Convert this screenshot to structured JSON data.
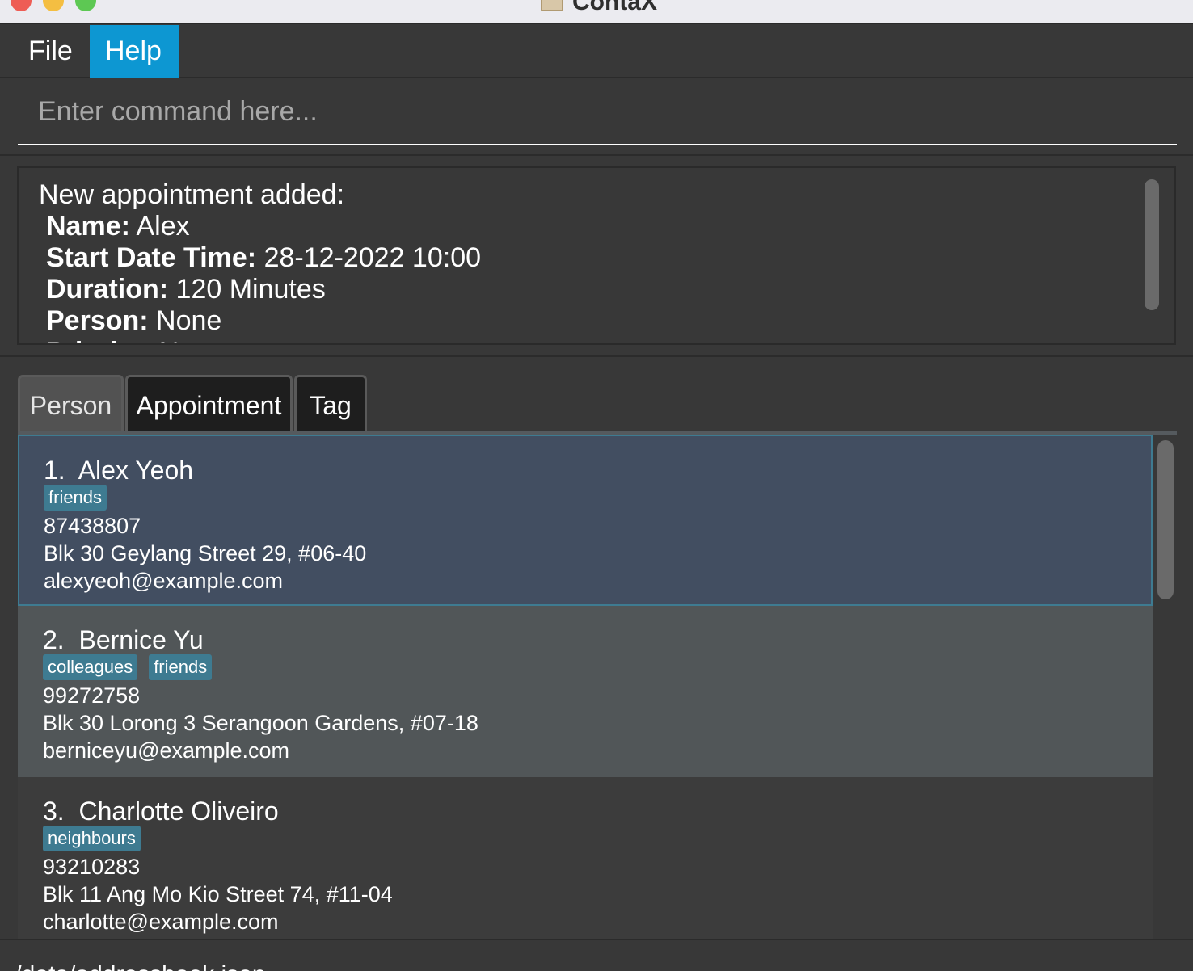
{
  "window": {
    "title": "ContaX"
  },
  "menu": {
    "file_label": "File",
    "help_label": "Help"
  },
  "command": {
    "placeholder": "Enter command here...",
    "value": ""
  },
  "result": {
    "heading": "New appointment added:",
    "lines": [
      {
        "label": "Name:",
        "value": " Alex"
      },
      {
        "label": "Start Date Time:",
        "value": " 28-12-2022 10:00"
      },
      {
        "label": "Duration:",
        "value": " 120 Minutes"
      },
      {
        "label": "Person:",
        "value": " None"
      },
      {
        "label": "Priority:",
        "value": " None"
      }
    ]
  },
  "tabs": {
    "person": "Person",
    "appointment": "Appointment",
    "tag": "Tag"
  },
  "persons": [
    {
      "index": "1.",
      "name": "Alex Yeoh",
      "tags": [
        "friends"
      ],
      "phone": "87438807",
      "address": "Blk 30 Geylang Street 29, #06-40",
      "email": "alexyeoh@example.com"
    },
    {
      "index": "2.",
      "name": "Bernice Yu",
      "tags": [
        "colleagues",
        "friends"
      ],
      "phone": "99272758",
      "address": "Blk 30 Lorong 3 Serangoon Gardens, #07-18",
      "email": "berniceyu@example.com"
    },
    {
      "index": "3.",
      "name": "Charlotte Oliveiro",
      "tags": [
        "neighbours"
      ],
      "phone": "93210283",
      "address": "Blk 11 Ang Mo Kio Street 74, #11-04",
      "email": "charlotte@example.com"
    }
  ],
  "status": {
    "path": "./data/addressbook.json"
  },
  "colors": {
    "accent": "#0d97d2",
    "tag": "#3e7b91",
    "selected_card": "#424e61",
    "background": "#383838"
  }
}
